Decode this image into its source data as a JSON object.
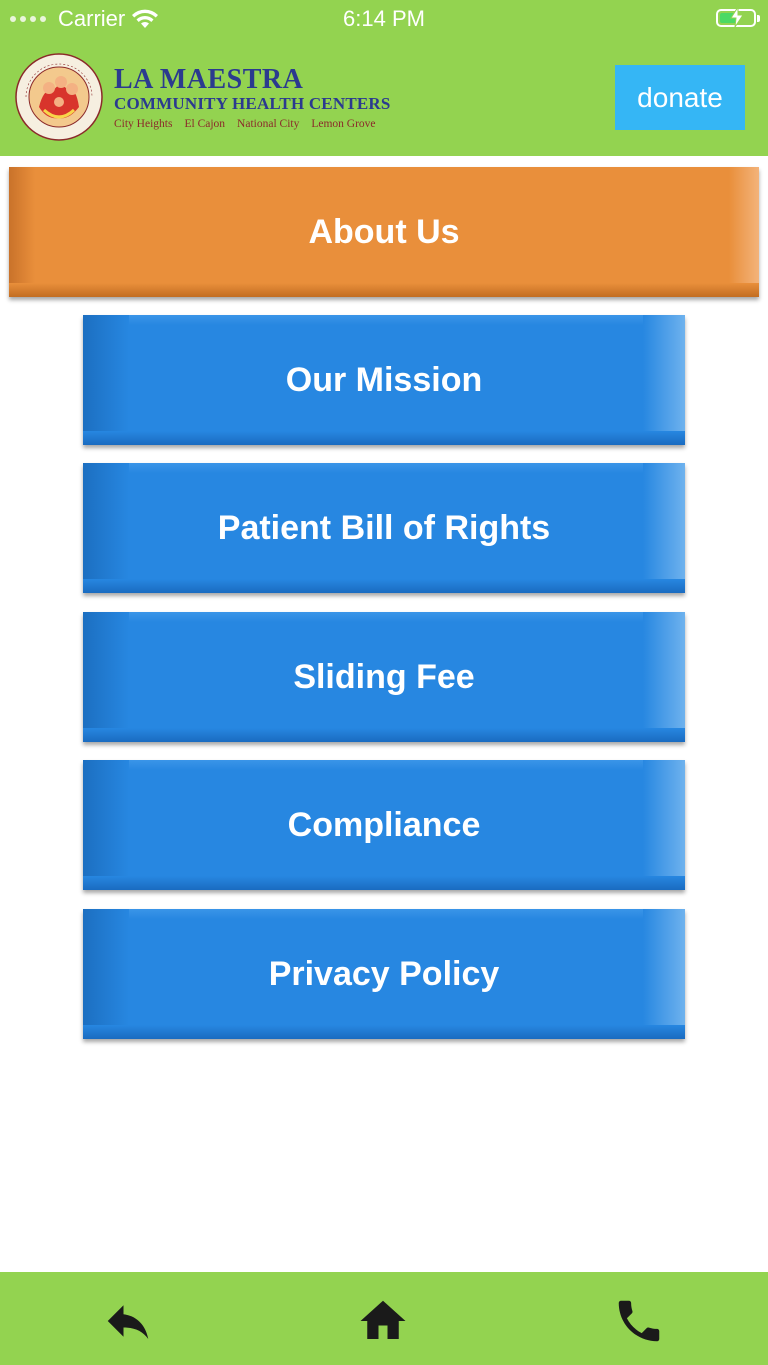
{
  "status_bar": {
    "carrier": "Carrier",
    "time": "6:14 PM"
  },
  "header": {
    "logo": {
      "name": "LA MAESTRA",
      "subtitle": "COMMUNITY HEALTH CENTERS",
      "locations": [
        "City Heights",
        "El Cajon",
        "National City",
        "Lemon Grove"
      ],
      "seal_text": "FAMILY · COMMUNITY · CARING · HEALTH · WELL BEING"
    },
    "donate_label": "donate"
  },
  "about": {
    "label": "About Us"
  },
  "menu": {
    "items": [
      {
        "label": "Our Mission"
      },
      {
        "label": "Patient Bill of Rights"
      },
      {
        "label": "Sliding Fee"
      },
      {
        "label": "Compliance"
      },
      {
        "label": "Privacy Policy"
      }
    ]
  },
  "bottom_nav": {
    "icons": [
      "reply-icon",
      "home-icon",
      "phone-icon"
    ]
  },
  "colors": {
    "header_green": "#93d350",
    "donate_blue": "#35b6f5",
    "about_orange": "#e98f3b",
    "menu_blue": "#2787e1",
    "logo_navy": "#2b3a8f",
    "logo_maroon": "#8b2a2a"
  }
}
